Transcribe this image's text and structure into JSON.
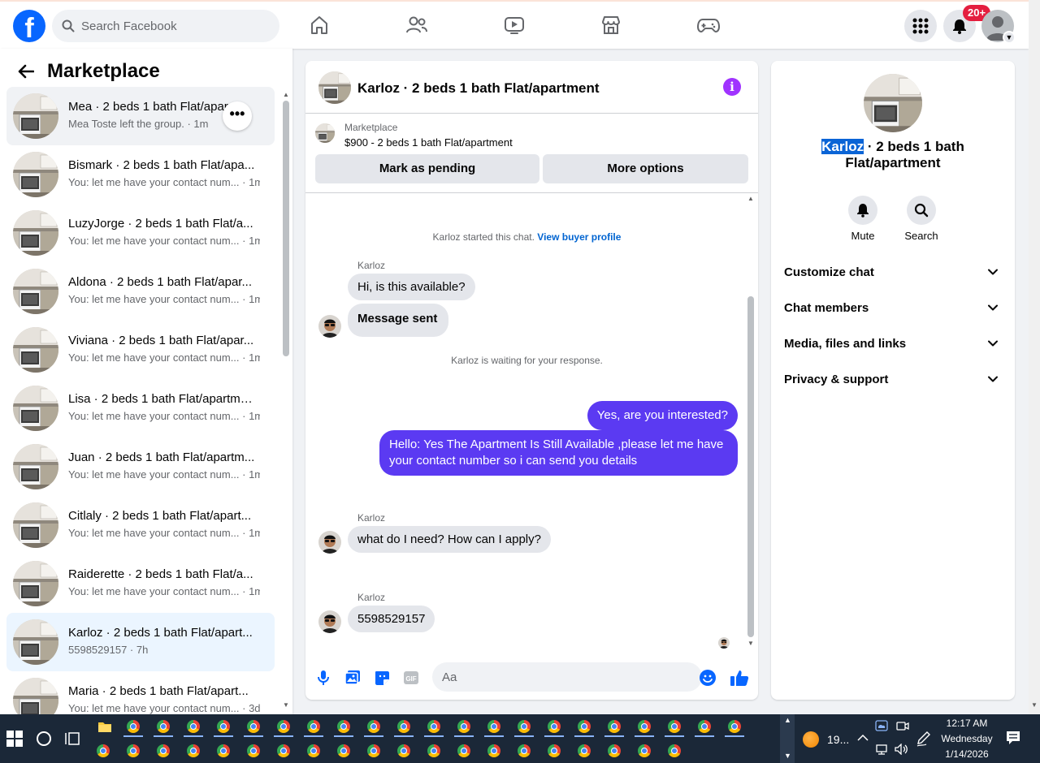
{
  "topbar": {
    "logo_letter": "f",
    "search_placeholder": "Search Facebook",
    "nav_icons": [
      "home-icon",
      "friends-icon",
      "video-icon",
      "marketplace-icon",
      "gaming-icon"
    ],
    "notification_badge": "20+",
    "colors": {
      "brand": "#0866ff",
      "badge": "#e41e3f"
    }
  },
  "sidebar": {
    "title": "Marketplace",
    "more_label": "•••",
    "conversations": [
      {
        "title": "Mea · 2 beds 1 bath Flat/apar...",
        "subtitle": "Mea Toste left the group. · 1m"
      },
      {
        "title": "Bismark · 2 beds 1 bath Flat/apa...",
        "subtitle": "You: let me have your contact num... · 1m"
      },
      {
        "title": "LuzyJorge · 2 beds 1 bath Flat/a...",
        "subtitle": "You: let me have your contact num... · 1m"
      },
      {
        "title": "Aldona · 2 beds 1 bath Flat/apar...",
        "subtitle": "You: let me have your contact num... · 1m"
      },
      {
        "title": "Viviana · 2 beds 1 bath Flat/apar...",
        "subtitle": "You: let me have your contact num... · 1m"
      },
      {
        "title": "Lisa · 2 beds 1 bath Flat/apartme...",
        "subtitle": "You: let me have your contact num... · 1m"
      },
      {
        "title": "Juan · 2 beds 1 bath Flat/apartm...",
        "subtitle": "You: let me have your contact num... · 1m"
      },
      {
        "title": "Citlaly · 2 beds 1 bath Flat/apart...",
        "subtitle": "You: let me have your contact num... · 1m"
      },
      {
        "title": "Raiderette · 2 beds 1 bath Flat/a...",
        "subtitle": "You: let me have your contact num... · 1m"
      },
      {
        "title": "Karloz · 2 beds 1 bath Flat/apart...",
        "subtitle": "5598529157 · 7h"
      },
      {
        "title": "Maria · 2 beds 1 bath Flat/apart...",
        "subtitle": "You: let me have your contact num... · 3d"
      }
    ]
  },
  "chat": {
    "header_name": "Karloz · 2 beds 1 bath Flat/apartment",
    "info_glyph": "i",
    "listing_source": "Marketplace",
    "listing_title": "$900 - 2 beds 1 bath Flat/apartment",
    "mark_pending_label": "Mark as pending",
    "more_options_label": "More options",
    "started_text": "Karloz started this chat.",
    "view_profile_link": "View buyer profile",
    "sender_name": "Karloz",
    "msg1": "Hi, is this available?",
    "msg2": "Message sent",
    "waiting_text": "Karloz is waiting for your response.",
    "out1": "Yes, are you interested?",
    "out2": "Hello: Yes The Apartment Is Still Available ,please let me have your contact number so i can send you details",
    "msg3": "what do I need? How can I apply?",
    "msg4": "5598529157",
    "composer_placeholder": "Aa",
    "colors": {
      "outgoing_bubble": "#5b3af2",
      "incoming_bubble": "#e4e6eb",
      "link": "#0064d1"
    }
  },
  "info_panel": {
    "title_highlight": "Karloz",
    "title_rest": " · 2 beds 1 bath Flat/apartment",
    "mute_label": "Mute",
    "search_label": "Search",
    "sections": [
      "Customize chat",
      "Chat members",
      "Media, files and links",
      "Privacy & support"
    ]
  },
  "taskbar": {
    "weather_text": "19...",
    "time": "12:17 AM",
    "day": "Wednesday",
    "date": "1/14/2026"
  }
}
